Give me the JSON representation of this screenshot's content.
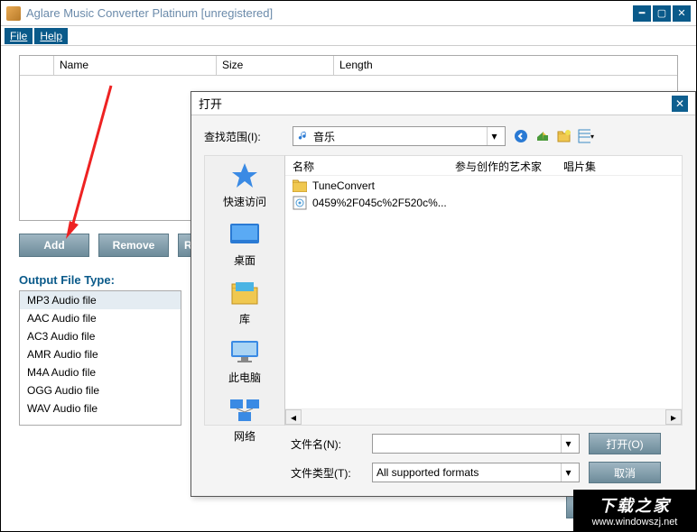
{
  "window": {
    "title": "Aglare Music Converter Platinum  [unregistered]"
  },
  "menubar": [
    "File",
    "Help"
  ],
  "fileTable": {
    "columns": {
      "name": "Name",
      "size": "Size",
      "length": "Length"
    }
  },
  "buttons": {
    "add": "Add",
    "remove": "Remove",
    "re": "Re"
  },
  "outputSection": {
    "label": "Output File Type:",
    "items": [
      "MP3 Audio file",
      "AAC Audio file",
      "AC3 Audio file",
      "AMR Audio file",
      "M4A Audio file",
      "OGG Audio file",
      "WAV Audio file"
    ]
  },
  "openDialog": {
    "title": "打开",
    "lookInLabel": "查找范围(I):",
    "lookInValue": "音乐",
    "columns": {
      "name": "名称",
      "artist": "参与创作的艺术家",
      "album": "唱片集"
    },
    "items": [
      {
        "kind": "folder",
        "name": "TuneConvert"
      },
      {
        "kind": "file",
        "name": "0459%2F045c%2F520c%..."
      }
    ],
    "places": [
      {
        "key": "quick",
        "label": "快速访问"
      },
      {
        "key": "desktop",
        "label": "桌面"
      },
      {
        "key": "libs",
        "label": "库"
      },
      {
        "key": "pc",
        "label": "此电脑"
      },
      {
        "key": "net",
        "label": "网络"
      }
    ],
    "filenameLabel": "文件名(N):",
    "filenameValue": "",
    "filetypeLabel": "文件类型(T):",
    "filetypeValue": "All supported formats",
    "openBtn": "打开(O)",
    "cancelBtn": "取消"
  },
  "watermark": {
    "line1": "下载之家",
    "line2": "www.windowszj.net"
  }
}
